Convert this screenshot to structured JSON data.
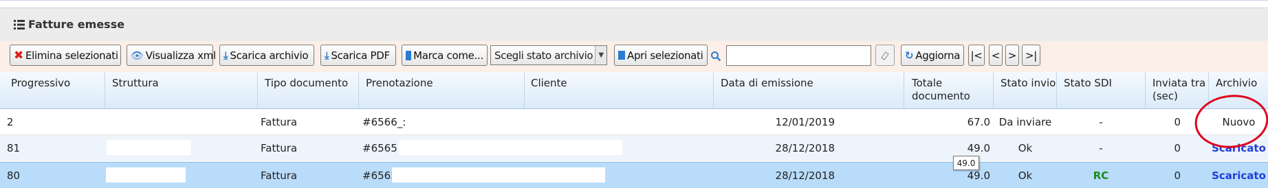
{
  "header": {
    "title": "Fatture emesse",
    "icon": "list-icon"
  },
  "toolbar": {
    "delete_label": "Elimina selezionati",
    "view_xml_label": "Visualizza xml",
    "download_archive_label": "Scarica archivio",
    "download_pdf_label": "Scarica PDF",
    "mark_as_label": "Marca come...",
    "archive_state_select": "Scegli stato archivio",
    "open_selected_label": "Apri selezionati",
    "search_value": "",
    "refresh_label": "Aggiorna",
    "first_label": "|<",
    "prev_label": "<",
    "next_label": ">",
    "last_label": ">|"
  },
  "table": {
    "columns": {
      "progressivo": "Progressivo",
      "struttura": "Struttura",
      "tipo": "Tipo documento",
      "prenotazione": "Prenotazione",
      "cliente": "Cliente",
      "data": "Data di emissione",
      "totale_1": "Totale",
      "totale_2": "documento",
      "stato_invio": "Stato invio",
      "stato_sdi": "Stato SDI",
      "inviata_1": "Inviata tra",
      "inviata_2": "(sec)",
      "archivio": "Archivio"
    },
    "rows": [
      {
        "progressivo": "2",
        "struttura": "",
        "tipo": "Fattura",
        "prenotazione": "#6566_:",
        "cliente": "",
        "data": "12/01/2019",
        "totale": "67.0",
        "stato_invio": "Da inviare",
        "stato_sdi": "-",
        "inviata": "0",
        "archivio": "Nuovo"
      },
      {
        "progressivo": "81",
        "struttura": "",
        "tipo": "Fattura",
        "prenotazione": "#6565",
        "cliente": "",
        "data": "28/12/2018",
        "totale": "49.0",
        "stato_invio": "Ok",
        "stato_sdi": "-",
        "inviata": "0",
        "archivio": "Scaricato"
      },
      {
        "progressivo": "80",
        "struttura": "",
        "tipo": "Fattura",
        "prenotazione": "#6565",
        "cliente": "",
        "data": "28/12/2018",
        "totale": "49.0",
        "stato_invio": "Ok",
        "stato_sdi": "RC",
        "inviata": "0",
        "archivio": "Scaricato"
      }
    ]
  },
  "tooltip": "49.0",
  "colors": {
    "link": "#1f3fd6",
    "sdi_ok": "#1a8a1a",
    "selected_row": "#b9dcfa",
    "annotation": "#e0001b"
  }
}
